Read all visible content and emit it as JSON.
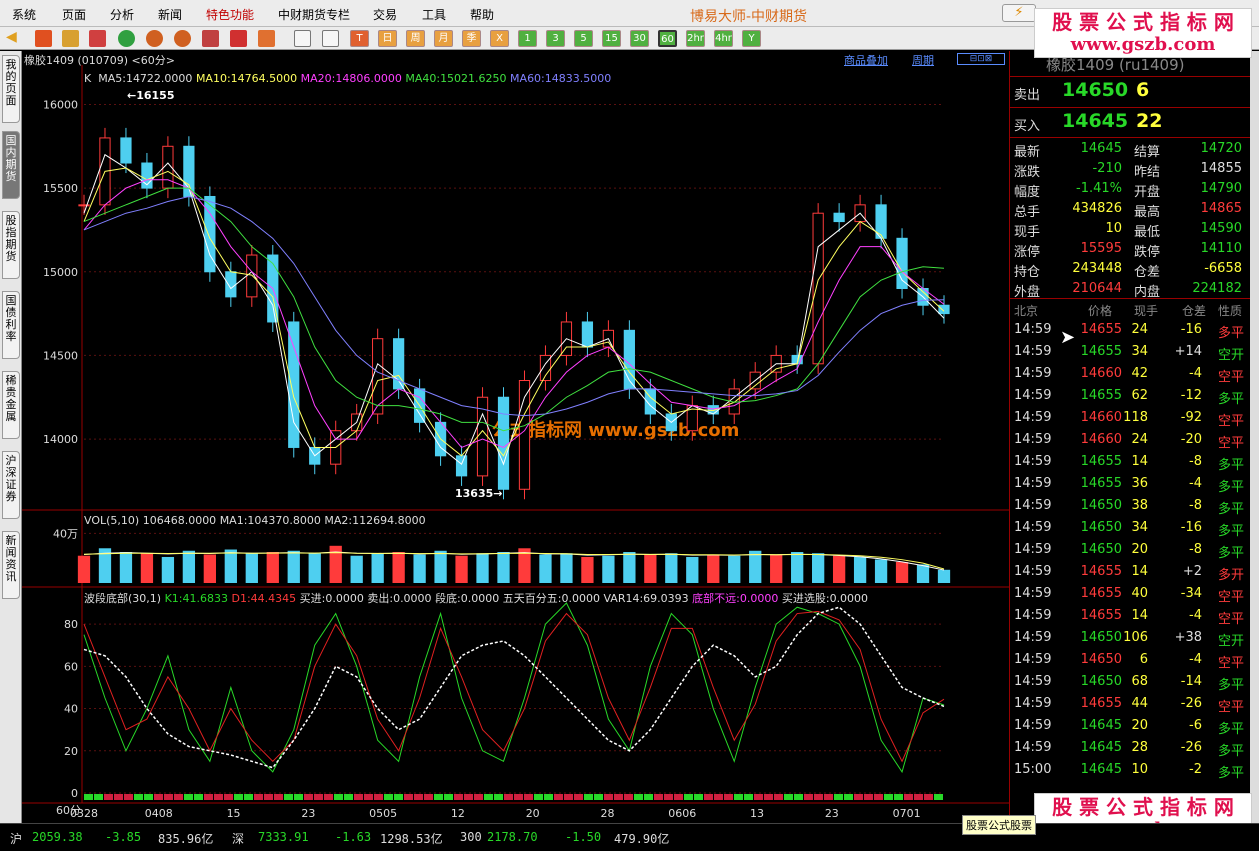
{
  "menu": {
    "items": [
      "系统",
      "页面",
      "分析",
      "新闻",
      "特色功能",
      "中财期货专栏",
      "交易",
      "工具",
      "帮助"
    ],
    "title": "博易大师-中财期货"
  },
  "toolbar": {
    "periods": [
      "日",
      "周",
      "月",
      "季",
      "X",
      "1",
      "3",
      "5",
      "15",
      "30",
      "60",
      "2hr",
      "4hr",
      "Y"
    ]
  },
  "left_tabs": [
    "我的页面",
    "国内期货",
    "股指期货",
    "国债利率",
    "稀贵金属",
    "沪深证券",
    "新闻资讯"
  ],
  "chart": {
    "symbol_header": "橡胶1409 (010709) <60分>",
    "links": [
      "商品叠加",
      "周期"
    ],
    "k_legend": {
      "k": "K",
      "ma5": "MA5:14722.0000",
      "ma10": "MA10:14764.5000",
      "ma20": "MA20:14806.0000",
      "ma40": "MA40:15021.6250",
      "ma60": "MA60:14833.5000"
    },
    "high_label": "16155",
    "low_label": "13635",
    "watermark": "公式指标网 www.gszb.com",
    "vol_legend": {
      "title": "VOL(5,10)",
      "v": "106468.0000",
      "ma1": "MA1:104370.8000",
      "ma2": "MA2:112694.8000"
    },
    "vol_tick": "40万",
    "ind_legend": {
      "name": "波段底部(30,1)",
      "k1": "K1:41.6833",
      "d1": "D1:44.4345",
      "buy": "买进:0.0000",
      "sell": "卖出:0.0000",
      "seg": "段底:0.0000",
      "five": "五天百分五:0.0000",
      "var14": "VAR14:69.0393",
      "far": "底部不远:0.0000",
      "pick": "买进选股:0.0000"
    },
    "period_label": "60分",
    "x_ticks": [
      "0328",
      "0408",
      "15",
      "23",
      "0505",
      "12",
      "20",
      "28",
      "0606",
      "13",
      "23",
      "0701"
    ]
  },
  "chart_data": [
    {
      "type": "line",
      "title": "",
      "ylim": [
        13600,
        16200
      ],
      "y_ticks": [
        16000,
        15500,
        15000,
        14500,
        14000
      ],
      "series": [
        {
          "name": "K",
          "values": [
            15400,
            15800,
            15650,
            15500,
            15750,
            15450,
            15000,
            14850,
            15100,
            14700,
            13950,
            13850,
            14050,
            14150,
            14600,
            14300,
            14100,
            13900,
            13780,
            14250,
            13700,
            14350,
            14500,
            14700,
            14550,
            14650,
            14300,
            14150,
            14050,
            14200,
            14150,
            14300,
            14400,
            14500,
            14450,
            15350,
            15300,
            15400,
            15200,
            14900,
            14800,
            14750
          ]
        },
        {
          "name": "MA5",
          "values": [
            15350,
            15700,
            15620,
            15520,
            15650,
            15500,
            15100,
            14900,
            15000,
            14800,
            14100,
            13900,
            14000,
            14100,
            14450,
            14350,
            14150,
            13950,
            13850,
            14150,
            13850,
            14250,
            14450,
            14600,
            14550,
            14600,
            14350,
            14200,
            14100,
            14200,
            14150,
            14250,
            14350,
            14450,
            14450,
            15150,
            15250,
            15350,
            15200,
            14950,
            14850,
            14722
          ]
        },
        {
          "name": "MA10",
          "values": [
            15300,
            15600,
            15620,
            15550,
            15600,
            15520,
            15200,
            15000,
            14980,
            14850,
            14250,
            13950,
            13950,
            14050,
            14350,
            14380,
            14200,
            14000,
            13900,
            14050,
            13900,
            14150,
            14380,
            14550,
            14550,
            14580,
            14400,
            14250,
            14150,
            14180,
            14170,
            14220,
            14320,
            14420,
            14450,
            14950,
            15150,
            15300,
            15220,
            15000,
            14880,
            14764
          ]
        },
        {
          "name": "MA20",
          "values": [
            15250,
            15400,
            15500,
            15550,
            15550,
            15500,
            15350,
            15150,
            15000,
            14900,
            14550,
            14200,
            14000,
            14000,
            14200,
            14300,
            14250,
            14100,
            13950,
            14000,
            13950,
            14050,
            14250,
            14400,
            14500,
            14550,
            14450,
            14330,
            14220,
            14200,
            14180,
            14200,
            14270,
            14350,
            14420,
            14700,
            14950,
            15150,
            15150,
            15000,
            14900,
            14806
          ]
        },
        {
          "name": "MA40",
          "values": [
            15300,
            15350,
            15400,
            15450,
            15500,
            15500,
            15400,
            15300,
            15150,
            15050,
            14850,
            14550,
            14350,
            14250,
            14200,
            14200,
            14180,
            14150,
            14100,
            14100,
            14050,
            14080,
            14150,
            14250,
            14320,
            14400,
            14420,
            14400,
            14350,
            14300,
            14250,
            14220,
            14230,
            14260,
            14300,
            14450,
            14650,
            14850,
            14950,
            15000,
            15030,
            15021
          ]
        },
        {
          "name": "MA60",
          "values": [
            15250,
            15300,
            15350,
            15380,
            15420,
            15450,
            15420,
            15380,
            15300,
            15200,
            15050,
            14850,
            14650,
            14500,
            14400,
            14350,
            14300,
            14250,
            14200,
            14180,
            14150,
            14140,
            14150,
            14180,
            14220,
            14270,
            14300,
            14300,
            14290,
            14280,
            14270,
            14260,
            14260,
            14270,
            14290,
            14380,
            14520,
            14650,
            14750,
            14800,
            14830,
            14833
          ]
        }
      ]
    },
    {
      "type": "bar",
      "title": "",
      "ylim": [
        0,
        500000
      ],
      "y_ticks": [
        400000
      ],
      "series": [
        {
          "name": "VOL",
          "values": [
            220000,
            280000,
            250000,
            240000,
            210000,
            260000,
            230000,
            270000,
            240000,
            250000,
            260000,
            240000,
            300000,
            220000,
            240000,
            250000,
            230000,
            260000,
            220000,
            240000,
            250000,
            280000,
            230000,
            240000,
            210000,
            220000,
            250000,
            230000,
            240000,
            210000,
            230000,
            220000,
            260000,
            230000,
            250000,
            240000,
            220000,
            210000,
            190000,
            170000,
            150000,
            106468
          ]
        },
        {
          "name": "MA1",
          "values": [
            230000,
            240000,
            245000,
            240000,
            235000,
            240000,
            238000,
            245000,
            240000,
            242000,
            245000,
            240000,
            250000,
            240000,
            238000,
            240000,
            235000,
            240000,
            232000,
            235000,
            240000,
            245000,
            235000,
            235000,
            225000,
            228000,
            232000,
            230000,
            232000,
            225000,
            226000,
            224000,
            230000,
            228000,
            232000,
            230000,
            222000,
            212000,
            195000,
            170000,
            140000,
            104370
          ]
        },
        {
          "name": "MA2",
          "values": [
            232000,
            236000,
            240000,
            240000,
            238000,
            240000,
            240000,
            242000,
            240000,
            241000,
            242000,
            241000,
            245000,
            240000,
            239000,
            240000,
            237000,
            238000,
            235000,
            236000,
            238000,
            240000,
            238000,
            236000,
            230000,
            230000,
            232000,
            231000,
            232000,
            228000,
            228000,
            226000,
            229000,
            228000,
            230000,
            230000,
            226000,
            220000,
            208000,
            188000,
            160000,
            112694
          ]
        }
      ]
    },
    {
      "type": "line",
      "title": "",
      "ylim": [
        0,
        90
      ],
      "y_ticks": [
        80,
        60,
        40,
        20,
        0
      ],
      "series": [
        {
          "name": "K1",
          "values": [
            75,
            45,
            20,
            40,
            65,
            30,
            15,
            50,
            20,
            10,
            30,
            70,
            85,
            60,
            25,
            15,
            55,
            85,
            45,
            20,
            15,
            45,
            80,
            90,
            70,
            35,
            20,
            60,
            85,
            75,
            40,
            15,
            50,
            80,
            88,
            85,
            80,
            60,
            25,
            10,
            45,
            41.68
          ]
        },
        {
          "name": "D1",
          "values": [
            80,
            55,
            30,
            35,
            55,
            40,
            20,
            40,
            25,
            15,
            25,
            60,
            80,
            65,
            35,
            20,
            45,
            78,
            55,
            30,
            20,
            40,
            72,
            85,
            75,
            45,
            25,
            50,
            78,
            78,
            50,
            25,
            42,
            72,
            85,
            86,
            82,
            68,
            35,
            15,
            38,
            44.43
          ]
        },
        {
          "name": "VAR14",
          "values": [
            68,
            65,
            55,
            40,
            28,
            22,
            20,
            18,
            15,
            12,
            25,
            40,
            60,
            55,
            40,
            30,
            35,
            50,
            65,
            70,
            72,
            65,
            55,
            45,
            35,
            25,
            20,
            30,
            45,
            60,
            70,
            65,
            55,
            60,
            75,
            85,
            88,
            80,
            65,
            50,
            45,
            41
          ]
        }
      ]
    }
  ],
  "quote": {
    "name": "橡胶1409 (ru1409)",
    "sell": {
      "label": "卖出",
      "price": "14650",
      "vol": "6"
    },
    "buy": {
      "label": "买入",
      "price": "14645",
      "vol": "22"
    },
    "rows": [
      [
        {
          "k": "最新",
          "v": "14645",
          "c": "g"
        },
        {
          "k": "结算",
          "v": "14720",
          "c": "g"
        }
      ],
      [
        {
          "k": "涨跌",
          "v": "-210",
          "c": "g"
        },
        {
          "k": "昨结",
          "v": "14855",
          "c": "w"
        }
      ],
      [
        {
          "k": "幅度",
          "v": "-1.41%",
          "c": "g"
        },
        {
          "k": "开盘",
          "v": "14790",
          "c": "g"
        }
      ],
      [
        {
          "k": "总手",
          "v": "434826",
          "c": "y"
        },
        {
          "k": "最高",
          "v": "14865",
          "c": "r"
        }
      ],
      [
        {
          "k": "现手",
          "v": "10",
          "c": "y"
        },
        {
          "k": "最低",
          "v": "14590",
          "c": "g"
        }
      ],
      [
        {
          "k": "涨停",
          "v": "15595",
          "c": "r"
        },
        {
          "k": "跌停",
          "v": "14110",
          "c": "g"
        }
      ],
      [
        {
          "k": "持仓",
          "v": "243448",
          "c": "y"
        },
        {
          "k": "仓差",
          "v": "-6658",
          "c": "y"
        }
      ],
      [
        {
          "k": "外盘",
          "v": "210644",
          "c": "r"
        },
        {
          "k": "内盘",
          "v": "224182",
          "c": "g"
        }
      ]
    ],
    "tick_header": [
      "北京",
      "价格",
      "现手",
      "仓差",
      "性质"
    ],
    "ticks": [
      [
        "14:59",
        "14655",
        "24",
        "-16",
        "多平",
        "r",
        "y",
        "c"
      ],
      [
        "14:59",
        "14655",
        "34",
        "+14",
        "空开",
        "g",
        "w",
        "g"
      ],
      [
        "14:59",
        "14660",
        "42",
        "-4",
        "空平",
        "r",
        "y",
        "r"
      ],
      [
        "14:59",
        "14655",
        "62",
        "-12",
        "多平",
        "g",
        "y",
        "g"
      ],
      [
        "14:59",
        "14660",
        "118",
        "-92",
        "空平",
        "r",
        "y",
        "r"
      ],
      [
        "14:59",
        "14660",
        "24",
        "-20",
        "空平",
        "r",
        "y",
        "r"
      ],
      [
        "14:59",
        "14655",
        "14",
        "-8",
        "多平",
        "g",
        "y",
        "g"
      ],
      [
        "14:59",
        "14655",
        "36",
        "-4",
        "多平",
        "g",
        "y",
        "g"
      ],
      [
        "14:59",
        "14650",
        "38",
        "-8",
        "多平",
        "g",
        "y",
        "g"
      ],
      [
        "14:59",
        "14650",
        "34",
        "-16",
        "多平",
        "g",
        "y",
        "g"
      ],
      [
        "14:59",
        "14650",
        "20",
        "-8",
        "多平",
        "g",
        "y",
        "g"
      ],
      [
        "14:59",
        "14655",
        "14",
        "+2",
        "多开",
        "r",
        "w",
        "r"
      ],
      [
        "14:59",
        "14655",
        "40",
        "-34",
        "空平",
        "r",
        "y",
        "r"
      ],
      [
        "14:59",
        "14655",
        "14",
        "-4",
        "空平",
        "r",
        "y",
        "r"
      ],
      [
        "14:59",
        "14650",
        "106",
        "+38",
        "空开",
        "g",
        "w",
        "g"
      ],
      [
        "14:59",
        "14650",
        "6",
        "-4",
        "空平",
        "r",
        "y",
        "r"
      ],
      [
        "14:59",
        "14650",
        "68",
        "-14",
        "多平",
        "g",
        "y",
        "g"
      ],
      [
        "14:59",
        "14655",
        "44",
        "-26",
        "空平",
        "r",
        "y",
        "r"
      ],
      [
        "14:59",
        "14645",
        "20",
        "-6",
        "多平",
        "g",
        "y",
        "g"
      ],
      [
        "14:59",
        "14645",
        "28",
        "-26",
        "多平",
        "g",
        "y",
        "g"
      ],
      [
        "15:00",
        "14645",
        "10",
        "-2",
        "多平",
        "g",
        "y",
        "g"
      ]
    ]
  },
  "status": {
    "sh": {
      "label": "沪",
      "value": "2059.38",
      "change": "-3.85",
      "amount": "835.96亿"
    },
    "sz": {
      "label": "深",
      "value": "7333.91",
      "change": "-1.63",
      "amount": "1298.53亿"
    },
    "i300": {
      "label": "300",
      "value": "2178.70",
      "change": "-1.50",
      "amount": "479.90亿"
    },
    "tip": "股票公式股票"
  },
  "site_watermark": {
    "line1": "股 票 公 式 指 标 网",
    "line2": "www.gszb.com"
  }
}
